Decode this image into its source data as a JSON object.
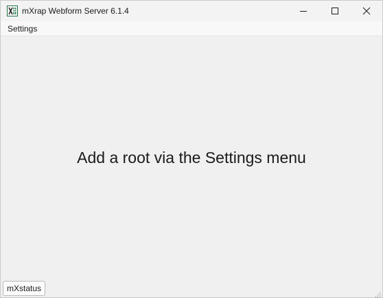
{
  "window": {
    "title": "mXrap Webform Server 6.1.4",
    "app_icon": "excel-sheet-icon",
    "controls": {
      "minimize": "minimize-icon",
      "maximize": "maximize-icon",
      "close": "close-icon"
    }
  },
  "menubar": {
    "items": [
      {
        "label": "Settings"
      }
    ]
  },
  "main": {
    "message": "Add a root via the Settings menu"
  },
  "status": {
    "button_label": "mXstatus"
  },
  "colors": {
    "app_icon_green": "#1d6f42",
    "window_background": "#f0f0f0"
  }
}
